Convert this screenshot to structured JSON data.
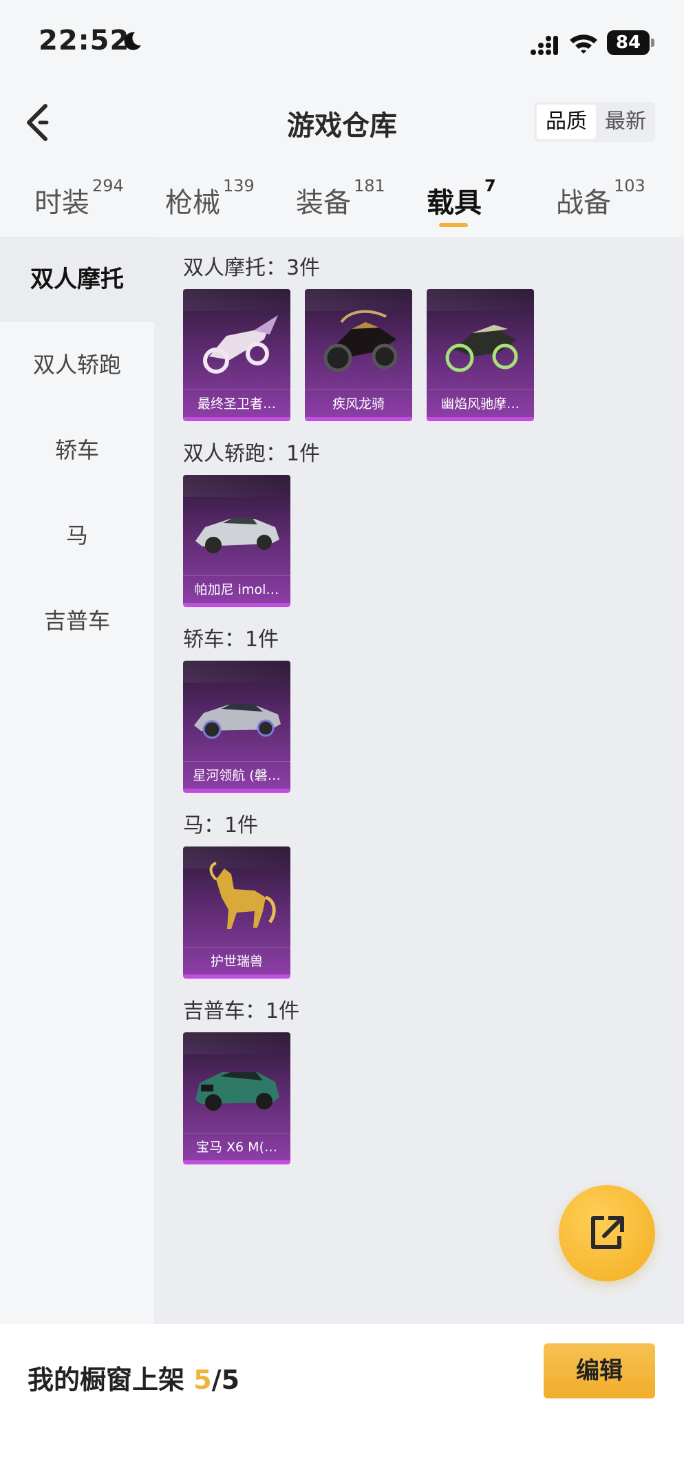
{
  "status_bar": {
    "time": "22:52",
    "battery": "84"
  },
  "header": {
    "title": "游戏仓库",
    "sort_quality": "品质",
    "sort_newest": "最新"
  },
  "tabs": [
    {
      "label": "时装",
      "count": "294"
    },
    {
      "label": "枪械",
      "count": "139"
    },
    {
      "label": "装备",
      "count": "181"
    },
    {
      "label": "载具",
      "count": "7"
    },
    {
      "label": "战备",
      "count": "103"
    }
  ],
  "sidebar": {
    "items": [
      "双人摩托",
      "双人轿跑",
      "轿车",
      "马",
      "吉普车"
    ]
  },
  "sections": [
    {
      "title": "双人摩托：3件",
      "items": [
        "最终圣卫者…",
        "疾风龙骑",
        "幽焰风驰摩…"
      ]
    },
    {
      "title": "双人轿跑：1件",
      "items": [
        "帕加尼 imol…"
      ]
    },
    {
      "title": "轿车：1件",
      "items": [
        "星河领航 (磐…"
      ]
    },
    {
      "title": "马：1件",
      "items": [
        "护世瑞兽"
      ]
    },
    {
      "title": "吉普车：1件",
      "items": [
        "宝马 X6 M(…"
      ]
    }
  ],
  "bottom": {
    "shelf_label": "我的橱窗上架",
    "shelf_count": "5",
    "shelf_total": "/5",
    "edit_label": "编辑"
  },
  "colors": {
    "accent": "#f1b43a",
    "card_purple": "#8c3ea6"
  }
}
